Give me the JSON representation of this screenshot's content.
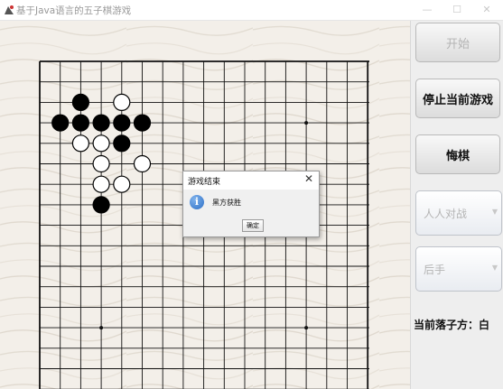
{
  "window": {
    "title": "基于Java语言的五子棋游戏",
    "minimize": "—",
    "maximize": "☐",
    "close": "✕"
  },
  "board": {
    "stones": [
      {
        "col": 2,
        "row": 2,
        "color": "black"
      },
      {
        "col": 4,
        "row": 2,
        "color": "white"
      },
      {
        "col": 1,
        "row": 3,
        "color": "black"
      },
      {
        "col": 2,
        "row": 3,
        "color": "black"
      },
      {
        "col": 3,
        "row": 3,
        "color": "black"
      },
      {
        "col": 4,
        "row": 3,
        "color": "black"
      },
      {
        "col": 5,
        "row": 3,
        "color": "black"
      },
      {
        "col": 2,
        "row": 4,
        "color": "white"
      },
      {
        "col": 3,
        "row": 4,
        "color": "white"
      },
      {
        "col": 4,
        "row": 4,
        "color": "black"
      },
      {
        "col": 3,
        "row": 5,
        "color": "white"
      },
      {
        "col": 5,
        "row": 5,
        "color": "white"
      },
      {
        "col": 3,
        "row": 6,
        "color": "white"
      },
      {
        "col": 4,
        "row": 6,
        "color": "white"
      },
      {
        "col": 3,
        "row": 7,
        "color": "black"
      }
    ]
  },
  "panel": {
    "start_label": "开始",
    "stop_label": "停止当前游戏",
    "undo_label": "悔棋",
    "mode_value": "人人对战",
    "order_value": "后手",
    "current_player": "当前落子方：白"
  },
  "dialog": {
    "title": "游戏结束",
    "message": "黑方获胜",
    "ok_label": "确定"
  }
}
